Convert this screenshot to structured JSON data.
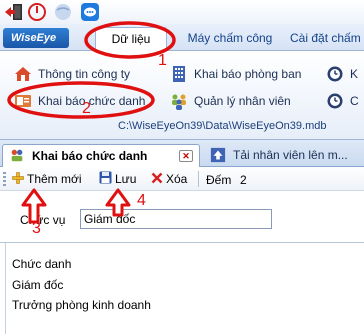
{
  "app": {
    "badge": "WiseEye"
  },
  "quick_access": [
    {
      "icon": "exit-icon"
    },
    {
      "icon": "power-icon"
    },
    {
      "icon": "globe-icon"
    },
    {
      "icon": "chat-icon"
    }
  ],
  "ribbon_tabs": [
    {
      "label": "Dữ liệu",
      "active": true
    },
    {
      "label": "Máy chấm công",
      "active": false
    },
    {
      "label": "Cài đặt chấm",
      "active": false
    }
  ],
  "ribbon_items": [
    {
      "label": "Thông tin công ty",
      "icon": "home-icon"
    },
    {
      "label": "Khai báo chức danh",
      "icon": "title-card-icon"
    },
    {
      "label": "Khai báo phòng ban",
      "icon": "building-icon"
    },
    {
      "label": "Quản lý nhân viên",
      "icon": "people-icon"
    },
    {
      "label": "K",
      "icon": "clock-icon"
    },
    {
      "label": "C",
      "icon": "clock-icon"
    }
  ],
  "db_path": "C:\\WiseEyeOn39\\Data\\WiseEyeOn39.mdb",
  "doc_tabs": [
    {
      "label": "Khai báo chức danh",
      "active": true,
      "closable": true
    },
    {
      "label": "Tải nhân viên lên m...",
      "active": false,
      "closable": false
    }
  ],
  "toolbar": {
    "add_label": "Thêm mới",
    "save_label": "Lưu",
    "delete_label": "Xóa",
    "count_label": "Đếm",
    "count_value": "2"
  },
  "form": {
    "label": "Chức vụ",
    "value": "Giám đốc"
  },
  "list": {
    "header": "Chức danh",
    "rows": [
      "Giám đốc",
      "Trưởng phòng kinh doanh"
    ]
  },
  "annotations": [
    "1",
    "2",
    "3",
    "4"
  ],
  "colors": {
    "annotation": "#e01010",
    "ribbon_text": "#15428b",
    "accent": "#1a56a8"
  }
}
